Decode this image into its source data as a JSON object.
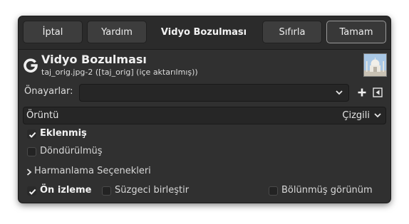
{
  "header": {
    "cancel_label": "İptal",
    "help_label": "Yardım",
    "title": "Vidyo Bozulması",
    "reset_label": "Sıfırla",
    "ok_label": "Tamam"
  },
  "operation": {
    "icon": "gimp-g-icon",
    "title": "Vidyo Bozulması",
    "subtitle": "taj_orig.jpg-2 ([taj_orig] (içe aktarılmış))"
  },
  "presets": {
    "label": "Önayarlar:",
    "value": ""
  },
  "pattern": {
    "label": "Örüntü",
    "value": "Çizgili"
  },
  "options": {
    "additive": {
      "label": "Eklenmiş",
      "checked": true
    },
    "rotated": {
      "label": "Döndürülmüş",
      "checked": false
    }
  },
  "blending": {
    "label": "Harmanlama Seçenekleri"
  },
  "footer": {
    "preview": {
      "label": "Ön izleme",
      "checked": true
    },
    "merge_filter": {
      "label": "Süzgeci birleştir",
      "checked": false
    },
    "split_view": {
      "label": "Bölünmüş görünüm",
      "checked": false
    }
  }
}
